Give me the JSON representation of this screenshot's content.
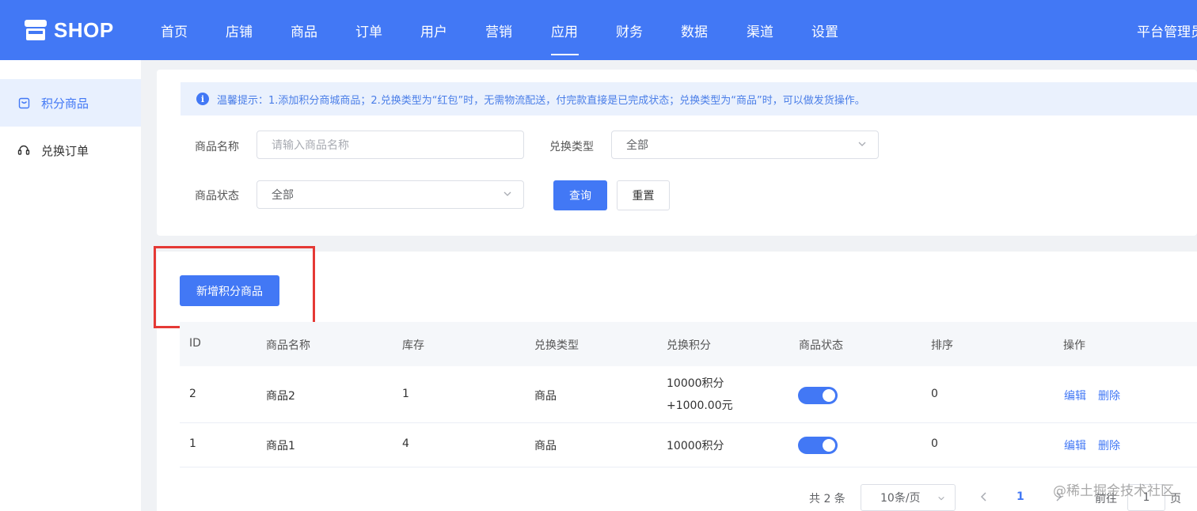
{
  "header": {
    "logo_text": "SHOP",
    "nav": [
      "首页",
      "店铺",
      "商品",
      "订单",
      "用户",
      "营销",
      "应用",
      "财务",
      "数据",
      "渠道",
      "设置"
    ],
    "active_nav": "应用",
    "admin_label": "平台管理员"
  },
  "sidebar": {
    "items": [
      {
        "label": "积分商品",
        "icon": "bag-icon",
        "active": true
      },
      {
        "label": "兑换订单",
        "icon": "headset-icon",
        "active": false
      }
    ]
  },
  "notice": {
    "text": "温馨提示：1.添加积分商城商品；2.兑换类型为“红包”时，无需物流配送，付完款直接是已完成状态；兑换类型为“商品”时，可以做发货操作。"
  },
  "filters": {
    "name_label": "商品名称",
    "name_placeholder": "请输入商品名称",
    "type_label": "兑换类型",
    "type_value": "全部",
    "status_label": "商品状态",
    "status_value": "全部",
    "query_button": "查询",
    "reset_button": "重置"
  },
  "actions": {
    "add_button": "新增积分商品"
  },
  "table": {
    "columns": [
      "ID",
      "商品名称",
      "库存",
      "兑换类型",
      "兑换积分",
      "商品状态",
      "排序",
      "操作"
    ],
    "rows": [
      {
        "id": "2",
        "name": "商品2",
        "stock": "1",
        "type": "商品",
        "points": "10000积分+1000.00元",
        "enabled": true,
        "sort": "0",
        "edit": "编辑",
        "delete": "删除"
      },
      {
        "id": "1",
        "name": "商品1",
        "stock": "4",
        "type": "商品",
        "points": "10000积分",
        "enabled": true,
        "sort": "0",
        "edit": "编辑",
        "delete": "删除"
      }
    ]
  },
  "pagination": {
    "total_text": "共 2 条",
    "page_size": "10条/页",
    "current_page": "1",
    "goto_prefix": "前往",
    "goto_value": "1",
    "goto_suffix": "页"
  },
  "watermark": "@稀土掘金技术社区",
  "colors": {
    "primary": "#4278f5",
    "highlight_box": "#e53935"
  }
}
